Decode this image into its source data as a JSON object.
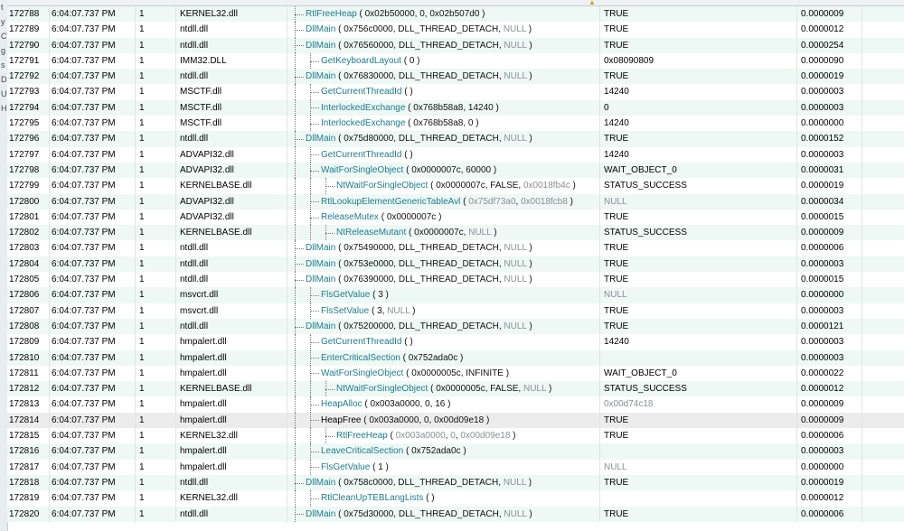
{
  "left_strip": [
    "t",
    "y",
    "C",
    "g",
    "s",
    "D",
    "U",
    "H"
  ],
  "rows": [
    {
      "idx": "172788",
      "time": "6:04:07.737 PM",
      "thread": "1",
      "module": "KERNEL32.dll",
      "depth": 0,
      "fn": "RtlFreeHeap",
      "args": [
        [
          "0x02b50000",
          ""
        ],
        [
          "0",
          ""
        ],
        [
          "0x02b507d0",
          ""
        ]
      ],
      "ret": "TRUE",
      "dur": "0.0000009"
    },
    {
      "idx": "172789",
      "time": "6:04:07.737 PM",
      "thread": "1",
      "module": "ntdll.dll",
      "depth": 0,
      "fn": "DllMain",
      "args": [
        [
          "0x756c0000",
          ""
        ],
        [
          "DLL_THREAD_DETACH",
          ""
        ],
        [
          "NULL",
          "dim"
        ]
      ],
      "ret": "TRUE",
      "dur": "0.0000012"
    },
    {
      "idx": "172790",
      "time": "6:04:07.737 PM",
      "thread": "1",
      "module": "ntdll.dll",
      "depth": 0,
      "fn": "DllMain",
      "args": [
        [
          "0x76560000",
          ""
        ],
        [
          "DLL_THREAD_DETACH",
          ""
        ],
        [
          "NULL",
          "dim"
        ]
      ],
      "ret": "TRUE",
      "dur": "0.0000254"
    },
    {
      "idx": "172791",
      "time": "6:04:07.737 PM",
      "thread": "1",
      "module": "IMM32.DLL",
      "depth": 1,
      "fn": "GetKeyboardLayout",
      "args": [
        [
          "0",
          ""
        ]
      ],
      "ret": "0x08090809",
      "dur": "0.0000090"
    },
    {
      "idx": "172792",
      "time": "6:04:07.737 PM",
      "thread": "1",
      "module": "ntdll.dll",
      "depth": 0,
      "fn": "DllMain",
      "args": [
        [
          "0x76830000",
          ""
        ],
        [
          "DLL_THREAD_DETACH",
          ""
        ],
        [
          "NULL",
          "dim"
        ]
      ],
      "ret": "TRUE",
      "dur": "0.0000019"
    },
    {
      "idx": "172793",
      "time": "6:04:07.737 PM",
      "thread": "1",
      "module": "MSCTF.dll",
      "depth": 1,
      "fn": "GetCurrentThreadId",
      "args": [],
      "ret": "14240",
      "dur": "0.0000003"
    },
    {
      "idx": "172794",
      "time": "6:04:07.737 PM",
      "thread": "1",
      "module": "MSCTF.dll",
      "depth": 1,
      "fn": "InterlockedExchange",
      "args": [
        [
          "0x768b58a8",
          ""
        ],
        [
          "14240",
          ""
        ]
      ],
      "ret": "0",
      "dur": "0.0000003"
    },
    {
      "idx": "172795",
      "time": "6:04:07.737 PM",
      "thread": "1",
      "module": "MSCTF.dll",
      "depth": 1,
      "fn": "InterlockedExchange",
      "args": [
        [
          "0x768b58a8",
          ""
        ],
        [
          "0",
          ""
        ]
      ],
      "ret": "14240",
      "dur": "0.0000000"
    },
    {
      "idx": "172796",
      "time": "6:04:07.737 PM",
      "thread": "1",
      "module": "ntdll.dll",
      "depth": 0,
      "fn": "DllMain",
      "args": [
        [
          "0x75d80000",
          ""
        ],
        [
          "DLL_THREAD_DETACH",
          ""
        ],
        [
          "NULL",
          "dim"
        ]
      ],
      "ret": "TRUE",
      "dur": "0.0000152"
    },
    {
      "idx": "172797",
      "time": "6:04:07.737 PM",
      "thread": "1",
      "module": "ADVAPI32.dll",
      "depth": 1,
      "fn": "GetCurrentThreadId",
      "args": [],
      "ret": "14240",
      "dur": "0.0000003"
    },
    {
      "idx": "172798",
      "time": "6:04:07.737 PM",
      "thread": "1",
      "module": "ADVAPI32.dll",
      "depth": 1,
      "fn": "WaitForSingleObject",
      "args": [
        [
          "0x0000007c",
          ""
        ],
        [
          "60000",
          ""
        ]
      ],
      "ret": "WAIT_OBJECT_0",
      "dur": "0.0000031"
    },
    {
      "idx": "172799",
      "time": "6:04:07.737 PM",
      "thread": "1",
      "module": "KERNELBASE.dll",
      "depth": 2,
      "fn": "NtWaitForSingleObject",
      "args": [
        [
          "0x0000007c",
          ""
        ],
        [
          "FALSE",
          ""
        ],
        [
          "0x0018fb4c",
          "dim"
        ]
      ],
      "ret": "STATUS_SUCCESS",
      "dur": "0.0000019"
    },
    {
      "idx": "172800",
      "time": "6:04:07.737 PM",
      "thread": "1",
      "module": "ADVAPI32.dll",
      "depth": 1,
      "fn": "RtlLookupElementGenericTableAvl",
      "args": [
        [
          "0x75df73a0",
          "dim"
        ],
        [
          "0x0018fcb8",
          "dim"
        ]
      ],
      "ret": "NULL",
      "retdim": true,
      "dur": "0.0000034"
    },
    {
      "idx": "172801",
      "time": "6:04:07.737 PM",
      "thread": "1",
      "module": "ADVAPI32.dll",
      "depth": 1,
      "fn": "ReleaseMutex",
      "args": [
        [
          "0x0000007c",
          ""
        ]
      ],
      "ret": "TRUE",
      "dur": "0.0000015"
    },
    {
      "idx": "172802",
      "time": "6:04:07.737 PM",
      "thread": "1",
      "module": "KERNELBASE.dll",
      "depth": 2,
      "fn": "NtReleaseMutant",
      "args": [
        [
          "0x0000007c",
          ""
        ],
        [
          "NULL",
          "dim"
        ]
      ],
      "ret": "STATUS_SUCCESS",
      "dur": "0.0000009"
    },
    {
      "idx": "172803",
      "time": "6:04:07.737 PM",
      "thread": "1",
      "module": "ntdll.dll",
      "depth": 0,
      "fn": "DllMain",
      "args": [
        [
          "0x75490000",
          ""
        ],
        [
          "DLL_THREAD_DETACH",
          ""
        ],
        [
          "NULL",
          "dim"
        ]
      ],
      "ret": "TRUE",
      "dur": "0.0000006"
    },
    {
      "idx": "172804",
      "time": "6:04:07.737 PM",
      "thread": "1",
      "module": "ntdll.dll",
      "depth": 0,
      "fn": "DllMain",
      "args": [
        [
          "0x753e0000",
          ""
        ],
        [
          "DLL_THREAD_DETACH",
          ""
        ],
        [
          "NULL",
          "dim"
        ]
      ],
      "ret": "TRUE",
      "dur": "0.0000003"
    },
    {
      "idx": "172805",
      "time": "6:04:07.737 PM",
      "thread": "1",
      "module": "ntdll.dll",
      "depth": 0,
      "fn": "DllMain",
      "args": [
        [
          "0x76390000",
          ""
        ],
        [
          "DLL_THREAD_DETACH",
          ""
        ],
        [
          "NULL",
          "dim"
        ]
      ],
      "ret": "TRUE",
      "dur": "0.0000015"
    },
    {
      "idx": "172806",
      "time": "6:04:07.737 PM",
      "thread": "1",
      "module": "msvcrt.dll",
      "depth": 1,
      "fn": "FlsGetValue",
      "args": [
        [
          "3",
          ""
        ]
      ],
      "ret": "NULL",
      "retdim": true,
      "dur": "0.0000000"
    },
    {
      "idx": "172807",
      "time": "6:04:07.737 PM",
      "thread": "1",
      "module": "msvcrt.dll",
      "depth": 1,
      "fn": "FlsSetValue",
      "args": [
        [
          "3",
          ""
        ],
        [
          "NULL",
          "dim"
        ]
      ],
      "ret": "TRUE",
      "dur": "0.0000003"
    },
    {
      "idx": "172808",
      "time": "6:04:07.737 PM",
      "thread": "1",
      "module": "ntdll.dll",
      "depth": 0,
      "fn": "DllMain",
      "args": [
        [
          "0x75200000",
          ""
        ],
        [
          "DLL_THREAD_DETACH",
          ""
        ],
        [
          "NULL",
          "dim"
        ]
      ],
      "ret": "TRUE",
      "dur": "0.0000121"
    },
    {
      "idx": "172809",
      "time": "6:04:07.737 PM",
      "thread": "1",
      "module": "hmpalert.dll",
      "depth": 1,
      "fn": "GetCurrentThreadId",
      "args": [],
      "ret": "14240",
      "dur": "0.0000003"
    },
    {
      "idx": "172810",
      "time": "6:04:07.737 PM",
      "thread": "1",
      "module": "hmpalert.dll",
      "depth": 1,
      "fn": "EnterCriticalSection",
      "args": [
        [
          "0x752ada0c",
          ""
        ]
      ],
      "ret": "",
      "dur": "0.0000003"
    },
    {
      "idx": "172811",
      "time": "6:04:07.737 PM",
      "thread": "1",
      "module": "hmpalert.dll",
      "depth": 1,
      "fn": "WaitForSingleObject",
      "args": [
        [
          "0x0000005c",
          ""
        ],
        [
          "INFINITE",
          ""
        ]
      ],
      "ret": "WAIT_OBJECT_0",
      "dur": "0.0000022"
    },
    {
      "idx": "172812",
      "time": "6:04:07.737 PM",
      "thread": "1",
      "module": "KERNELBASE.dll",
      "depth": 2,
      "fn": "NtWaitForSingleObject",
      "args": [
        [
          "0x0000005c",
          ""
        ],
        [
          "FALSE",
          ""
        ],
        [
          "NULL",
          "dim"
        ]
      ],
      "ret": "STATUS_SUCCESS",
      "dur": "0.0000012"
    },
    {
      "idx": "172813",
      "time": "6:04:07.737 PM",
      "thread": "1",
      "module": "hmpalert.dll",
      "depth": 1,
      "fn": "HeapAlloc",
      "args": [
        [
          "0x003a0000",
          ""
        ],
        [
          "0",
          ""
        ],
        [
          "16",
          ""
        ]
      ],
      "ret": "0x00d74c18",
      "retdim": true,
      "dur": "0.0000009"
    },
    {
      "idx": "172814",
      "time": "6:04:07.737 PM",
      "thread": "1",
      "module": "hmpalert.dll",
      "depth": 1,
      "fn": "HeapFree",
      "args": [
        [
          "0x003a0000",
          ""
        ],
        [
          "0",
          ""
        ],
        [
          "0x00d09e18",
          ""
        ]
      ],
      "ret": "TRUE",
      "dur": "0.0000009",
      "selected": true
    },
    {
      "idx": "172815",
      "time": "6:04:07.737 PM",
      "thread": "1",
      "module": "KERNEL32.dll",
      "depth": 2,
      "fn": "RtlFreeHeap",
      "args": [
        [
          "0x003a0000",
          "dim"
        ],
        [
          "0",
          "dim"
        ],
        [
          "0x00d09e18",
          "dim"
        ]
      ],
      "ret": "TRUE",
      "dur": "0.0000006"
    },
    {
      "idx": "172816",
      "time": "6:04:07.737 PM",
      "thread": "1",
      "module": "hmpalert.dll",
      "depth": 1,
      "fn": "LeaveCriticalSection",
      "args": [
        [
          "0x752ada0c",
          ""
        ]
      ],
      "ret": "",
      "dur": "0.0000003"
    },
    {
      "idx": "172817",
      "time": "6:04:07.737 PM",
      "thread": "1",
      "module": "hmpalert.dll",
      "depth": 1,
      "fn": "FlsGetValue",
      "args": [
        [
          "1",
          ""
        ]
      ],
      "ret": "NULL",
      "retdim": true,
      "dur": "0.0000000"
    },
    {
      "idx": "172818",
      "time": "6:04:07.737 PM",
      "thread": "1",
      "module": "ntdll.dll",
      "depth": 0,
      "fn": "DllMain",
      "args": [
        [
          "0x758c0000",
          ""
        ],
        [
          "DLL_THREAD_DETACH",
          ""
        ],
        [
          "NULL",
          "dim"
        ]
      ],
      "ret": "TRUE",
      "dur": "0.0000019"
    },
    {
      "idx": "172819",
      "time": "6:04:07.737 PM",
      "thread": "1",
      "module": "KERNEL32.dll",
      "depth": 1,
      "fn": "RtlCleanUpTEBLangLists",
      "args": [],
      "ret": "",
      "dur": "0.0000012"
    },
    {
      "idx": "172820",
      "time": "6:04:07.737 PM",
      "thread": "1",
      "module": "ntdll.dll",
      "depth": 0,
      "fn": "DllMain",
      "args": [
        [
          "0x75d30000",
          ""
        ],
        [
          "DLL_THREAD_DETACH",
          ""
        ],
        [
          "NULL",
          "dim"
        ]
      ],
      "ret": "TRUE",
      "dur": "0.0000006"
    }
  ]
}
